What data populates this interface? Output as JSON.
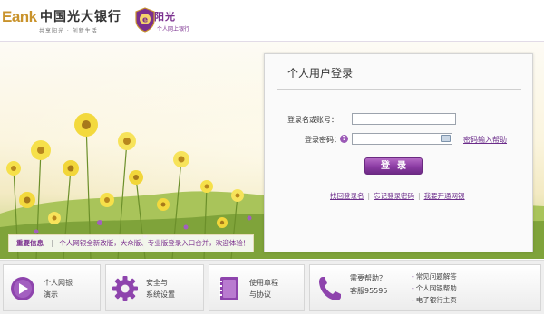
{
  "header": {
    "ebank_logo": "Eank",
    "bank_name": "中国光大银行",
    "slogan": "共享阳光 · 创新生活",
    "brand_name": "阳光",
    "brand_sub": "个人网上银行"
  },
  "login": {
    "title": "个人用户登录",
    "username_label": "登录名或账号：",
    "username_value": "",
    "password_label": "登录密码：",
    "password_value": "",
    "help_icon": "question-icon",
    "password_help_link": "密码输入帮助",
    "submit_label": "登录",
    "links": [
      "找回登录名",
      "忘记登录密码",
      "我要开通网银"
    ]
  },
  "notice": {
    "title": "重要信息",
    "text": "个人网银全新改版，大众版、专业版登录入口合并，欢迎体验！"
  },
  "bottom": {
    "cards": [
      {
        "line1": "个人网银",
        "line2": "演示",
        "icon": "play-icon"
      },
      {
        "line1": "安全与",
        "line2": "系统设置",
        "icon": "gear-icon"
      },
      {
        "line1": "使用章程",
        "line2": "与协议",
        "icon": "notebook-icon"
      }
    ],
    "help": {
      "title": "需要帮助？",
      "phone": "客服95595",
      "icon": "phone-icon",
      "links": [
        "常见问题解答",
        "个人网银帮助",
        "电子银行主页"
      ]
    }
  },
  "colors": {
    "brand_purple": "#7a2f8e",
    "button_purple": "#8a3aa2",
    "ebank_gold": "#c9932c"
  }
}
